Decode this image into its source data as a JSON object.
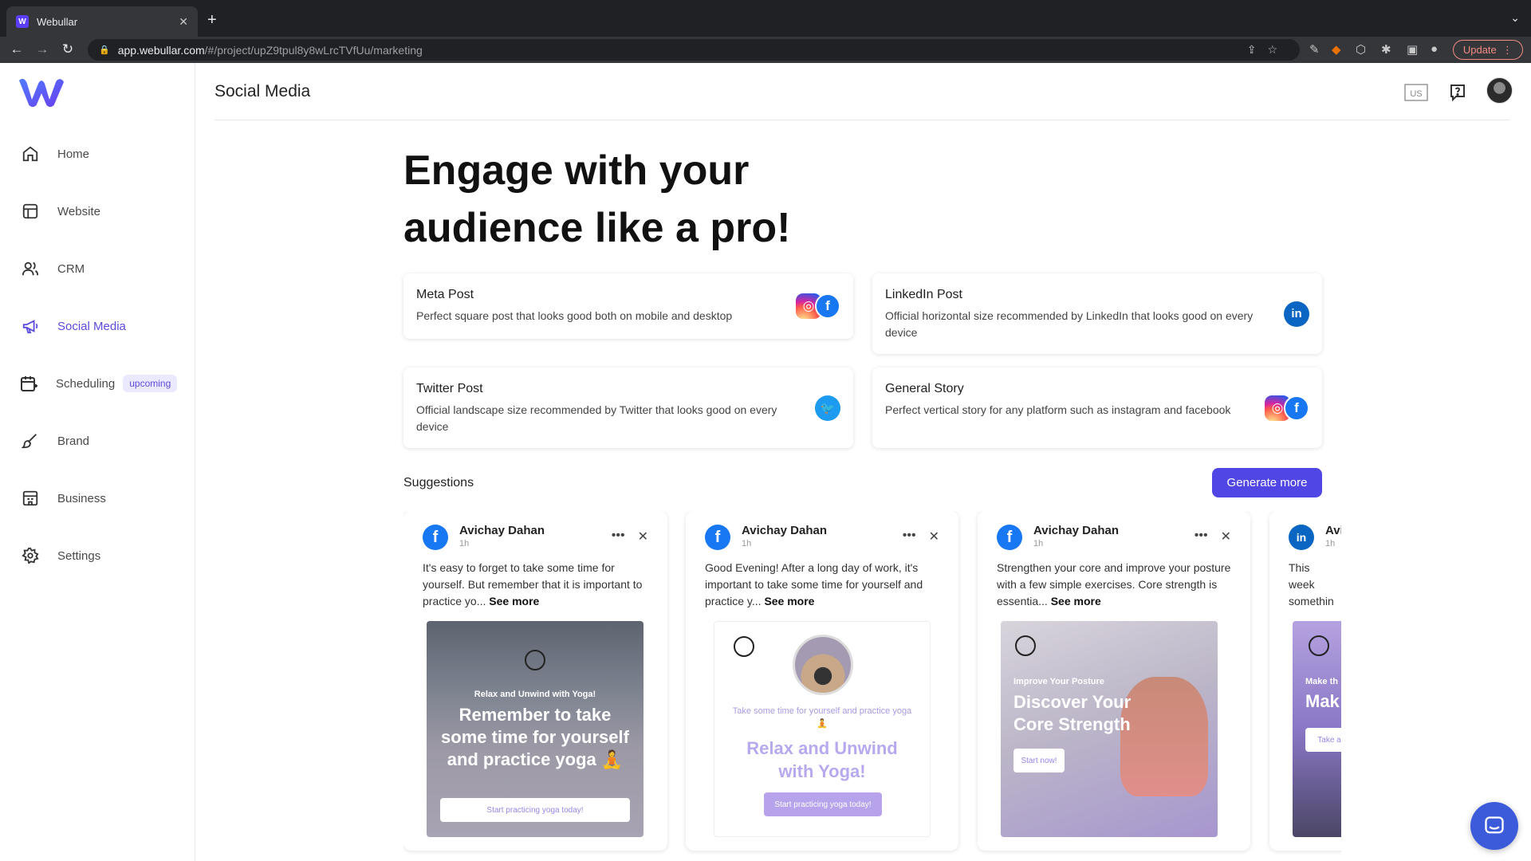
{
  "browser": {
    "tab_title": "Webullar",
    "url_host": "app.webullar.com",
    "url_path": "/#/project/upZ9tpul8y8wLrcTVfUu/marketing",
    "update_label": "Update"
  },
  "sidebar": {
    "items": [
      {
        "label": "Home",
        "icon": "home-icon"
      },
      {
        "label": "Website",
        "icon": "layout-icon"
      },
      {
        "label": "CRM",
        "icon": "users-icon"
      },
      {
        "label": "Social Media",
        "icon": "megaphone-icon",
        "active": true
      },
      {
        "label": "Scheduling",
        "icon": "calendar-icon",
        "badge": "upcoming"
      },
      {
        "label": "Brand",
        "icon": "brush-icon"
      },
      {
        "label": "Business",
        "icon": "building-icon"
      },
      {
        "label": "Settings",
        "icon": "gear-icon"
      }
    ]
  },
  "header": {
    "title": "Social Media",
    "lang": "US"
  },
  "hero": {
    "line1": "Engage with your",
    "line2": "audience like a pro!"
  },
  "post_types": [
    {
      "title": "Meta Post",
      "desc": "Perfect square post that looks good both on mobile and desktop",
      "icons": [
        "instagram-icon",
        "facebook-icon"
      ]
    },
    {
      "title": "LinkedIn Post",
      "desc": "Official horizontal size recommended by LinkedIn that looks good on every device",
      "icons": [
        "linkedin-icon"
      ]
    },
    {
      "title": "Twitter Post",
      "desc": "Official landscape size recommended by Twitter that looks good on every device",
      "icons": [
        "twitter-icon"
      ]
    },
    {
      "title": "General Story",
      "desc": "Perfect vertical story for any platform such as instagram and facebook",
      "icons": [
        "instagram-icon",
        "facebook-icon"
      ]
    }
  ],
  "suggestions": {
    "title": "Suggestions",
    "generate_label": "Generate more",
    "see_more": "See more",
    "posts": [
      {
        "platform": "facebook",
        "author": "Avichay Dahan",
        "time": "1h",
        "text": "It's easy to forget to take some time for yourself. But remember that it is important to practice yo...",
        "img_kicker": "Relax and Unwind with Yoga!",
        "img_headline": "Remember to take some time for yourself and practice yoga 🧘",
        "img_cta": "Start practicing yoga today!"
      },
      {
        "platform": "facebook",
        "author": "Avichay Dahan",
        "time": "1h",
        "text": "Good Evening! After a long day of work, it's important to take some time for yourself and practice y...",
        "img_kicker": "Take some time for yourself and practice yoga 🧘",
        "img_headline": "Relax and Unwind with Yoga!",
        "img_cta": "Start practicing yoga today!"
      },
      {
        "platform": "facebook",
        "author": "Avichay Dahan",
        "time": "1h",
        "text": "Strengthen your core and improve your posture with a few simple exercises. Core strength is essentia...",
        "img_kicker": "Improve Your Posture",
        "img_headline": "Discover Your Core Strength",
        "img_cta": "Start now!"
      },
      {
        "platform": "linkedin",
        "author": "Avi",
        "time": "1h",
        "text": "This week somethin pause an",
        "img_kicker": "Make th",
        "img_headline": "Mak",
        "img_cta": "Take a"
      }
    ]
  },
  "colors": {
    "accent": "#4f46e5",
    "active_nav": "#5b4bde",
    "facebook": "#1877f2",
    "linkedin": "#0a66c2",
    "twitter": "#1d9bf0"
  }
}
